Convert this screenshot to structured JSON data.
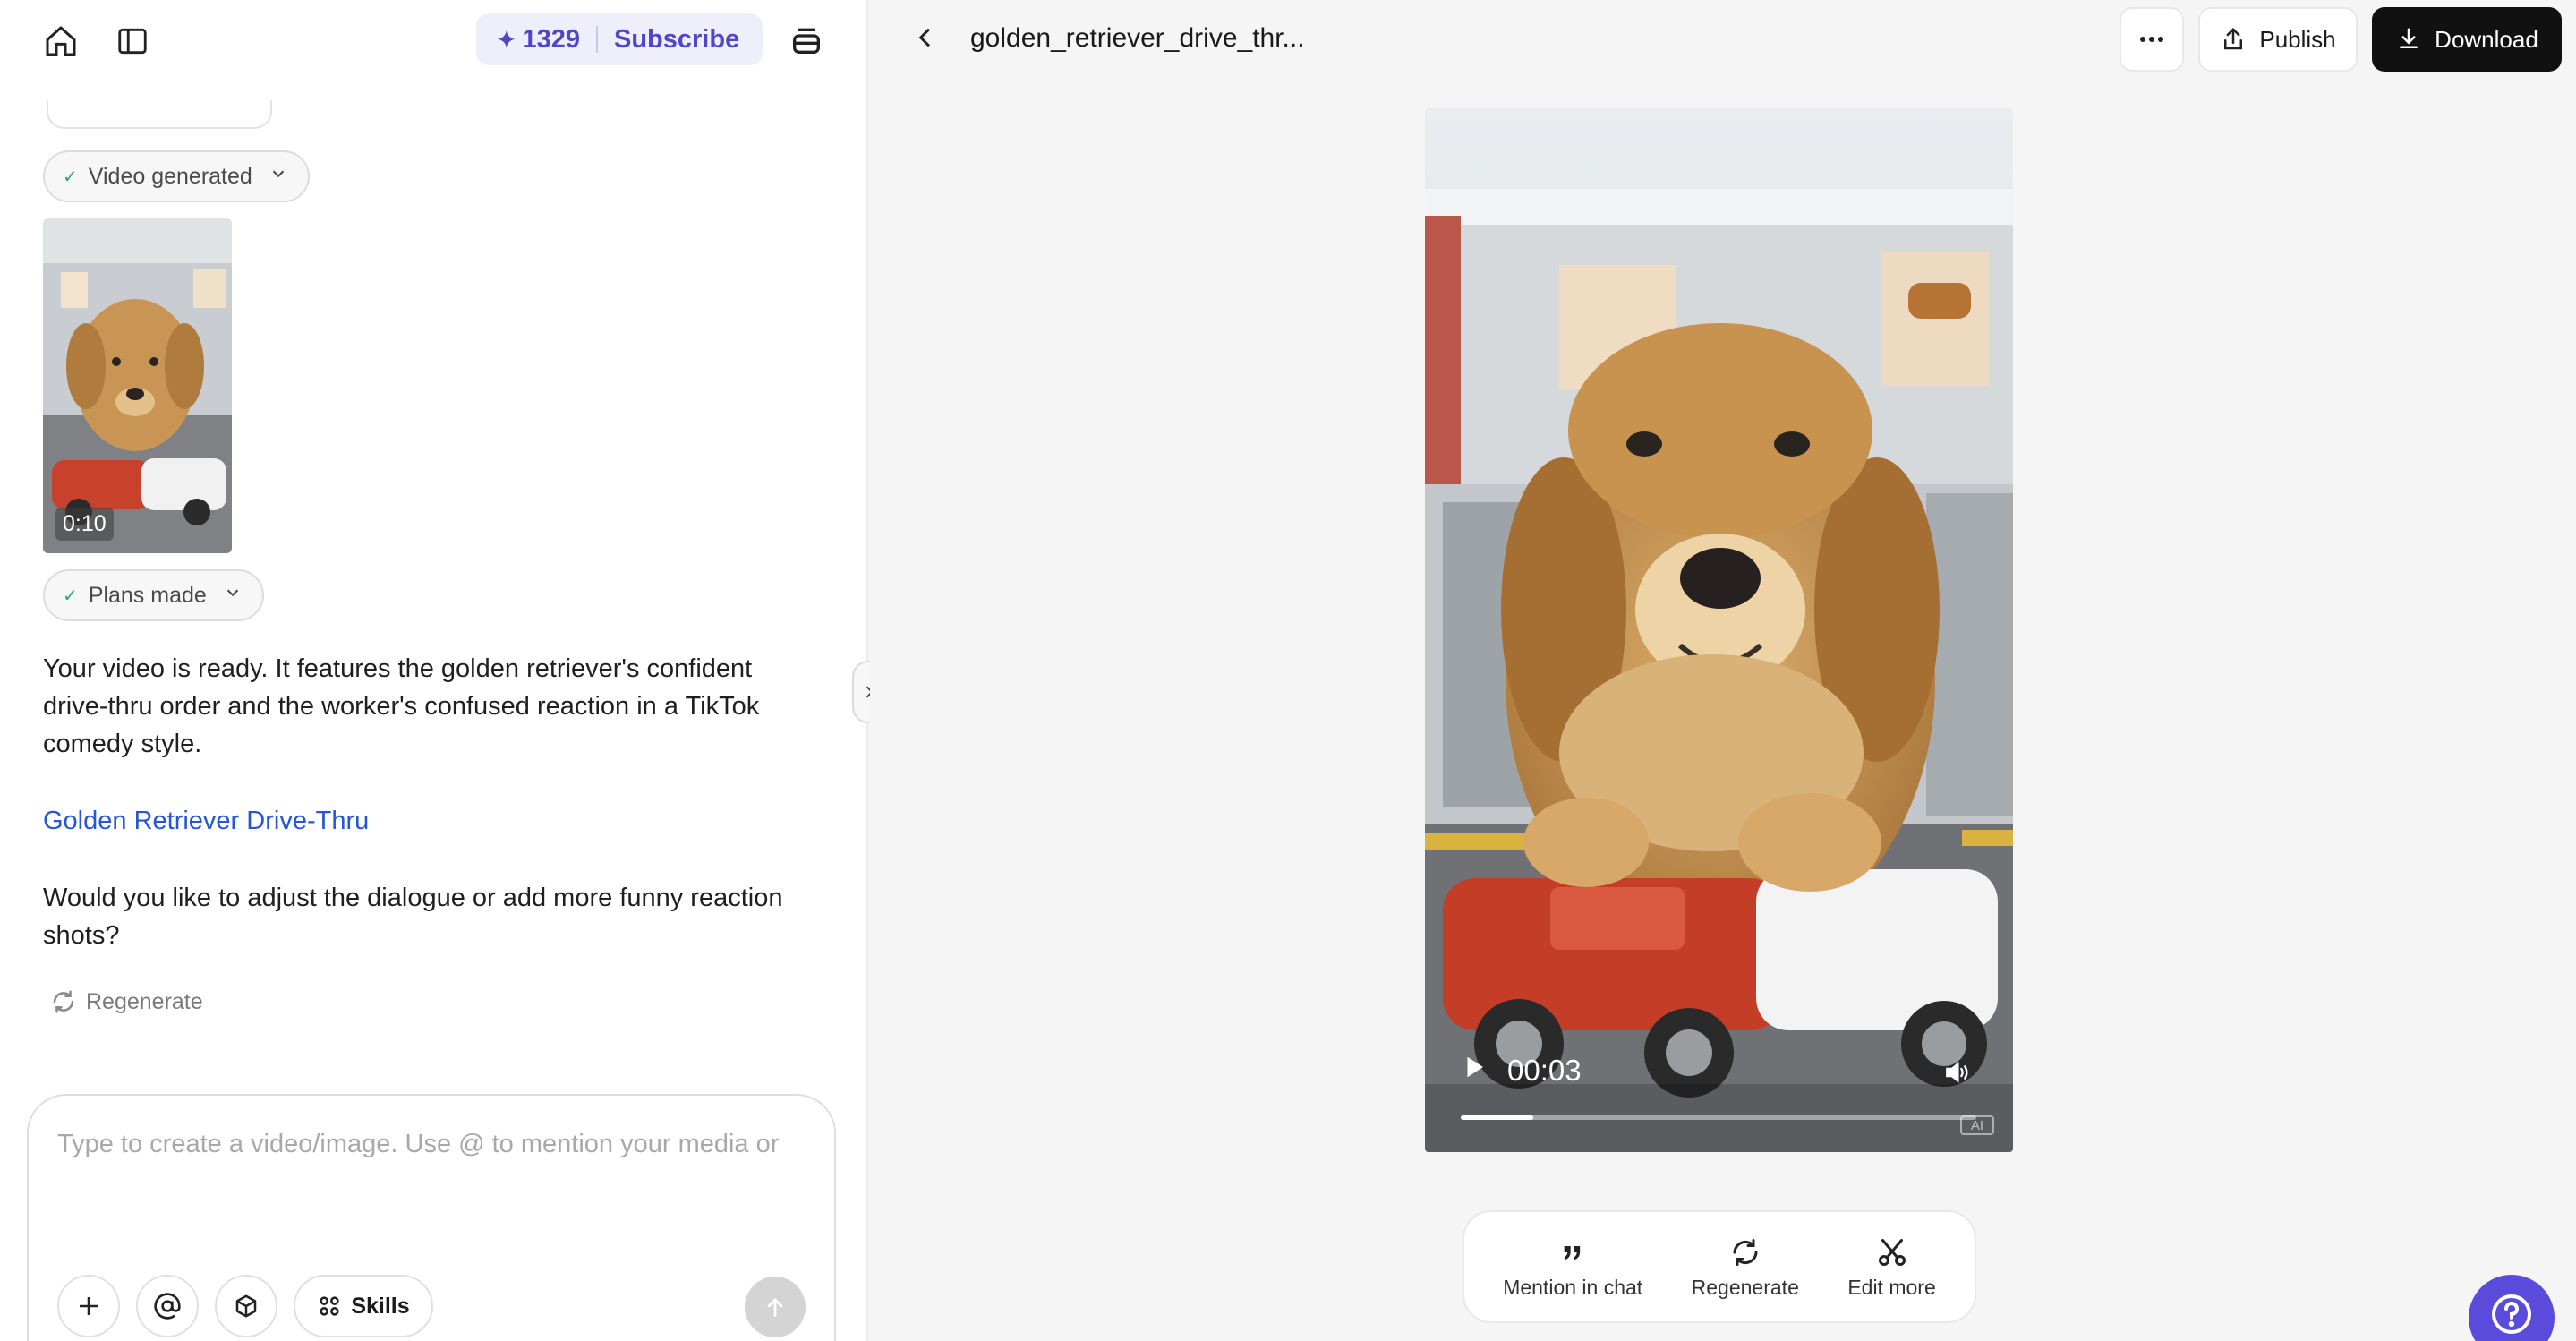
{
  "header": {
    "credits": "1329",
    "subscribe_label": "Subscribe",
    "credit_icon": "sparkle-icon"
  },
  "chat": {
    "video_status": "Video generated",
    "thumb_duration": "0:10",
    "plans_status": "Plans made",
    "message": "Your video is ready. It features the golden retriever's confident drive-thru order and the worker's confused reaction in a TikTok comedy style.",
    "link_text": "Golden Retriever Drive-Thru",
    "question": "Would you like to adjust the dialogue or add more funny reaction shots?",
    "regenerate_label": "Regenerate"
  },
  "composer": {
    "placeholder": "Type to create a video/image. Use @ to mention your media or",
    "skills_label": "Skills"
  },
  "viewer": {
    "title": "golden_retriever_drive_thr...",
    "publish_label": "Publish",
    "download_label": "Download",
    "current_time": "00:03",
    "progress_fraction": 0.14,
    "ai_badge": "AI"
  },
  "actions": {
    "mention_label": "Mention in chat",
    "regenerate_label": "Regenerate",
    "edit_label": "Edit more"
  },
  "colors": {
    "accent": "#5046c8",
    "link": "#2456d6",
    "check": "#2fa56b",
    "download_bg": "#111111",
    "help_bg": "#5a4bdc"
  }
}
